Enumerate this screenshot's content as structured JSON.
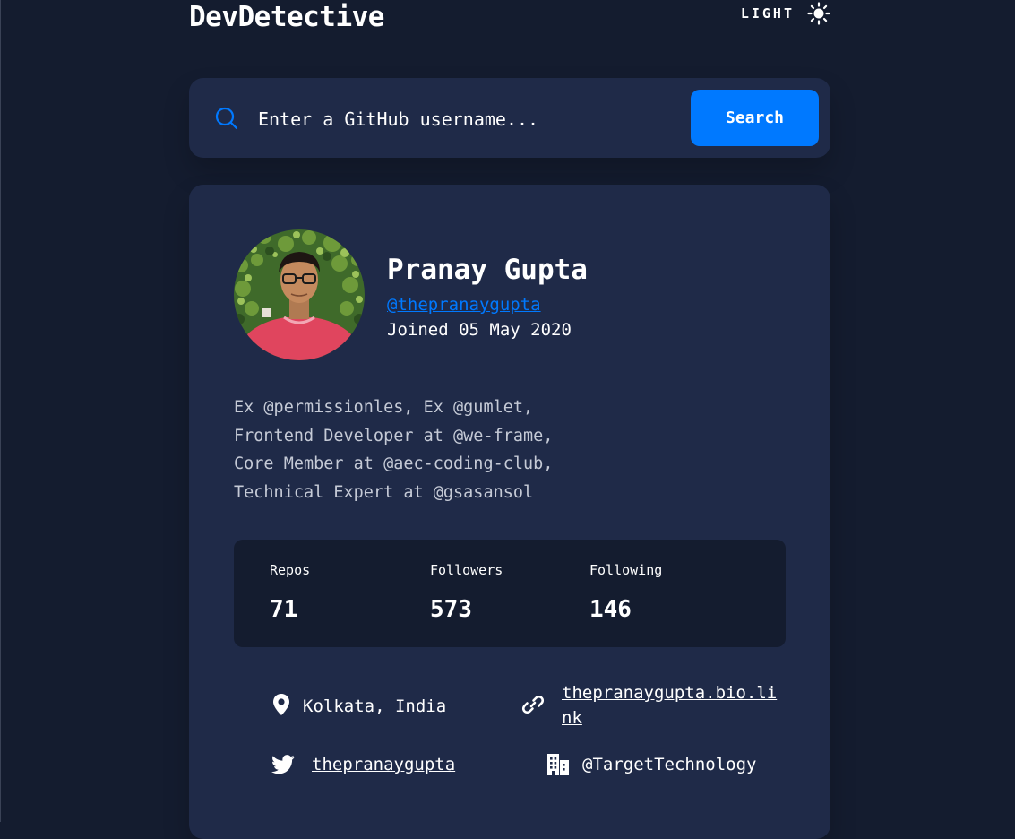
{
  "header": {
    "app_title": "DevDetective",
    "theme_label": "LIGHT",
    "theme_icon": "sun-icon"
  },
  "search": {
    "placeholder": "Enter a GitHub username...",
    "value": "",
    "button_label": "Search",
    "icon": "search-icon"
  },
  "profile": {
    "name": "Pranay Gupta",
    "login": "@thepranaygupta",
    "joined": "Joined 05 May 2020",
    "bio_lines": [
      "Ex @permissionles, Ex @gumlet,",
      "Frontend Developer at @we-frame,",
      "Core Member at @aec-coding-club,",
      "Technical Expert at @gsasansol"
    ]
  },
  "stats": {
    "repos": {
      "label": "Repos",
      "value": "71"
    },
    "followers": {
      "label": "Followers",
      "value": "573"
    },
    "following": {
      "label": "Following",
      "value": "146"
    }
  },
  "links": {
    "location": {
      "icon": "location-pin-icon",
      "text": "Kolkata, India"
    },
    "website": {
      "icon": "link-icon",
      "text_line1": "thepranaygupta.bio.li",
      "text_line2": "nk"
    },
    "twitter": {
      "icon": "twitter-icon",
      "text": "thepranaygupta"
    },
    "company": {
      "icon": "company-building-icon",
      "text": "@TargetTechnology"
    }
  },
  "colors": {
    "background": "#141c2f",
    "card": "#1f2a48",
    "accent": "#0079ff",
    "text": "#ffffff",
    "muted_text": "#c5cad6"
  }
}
